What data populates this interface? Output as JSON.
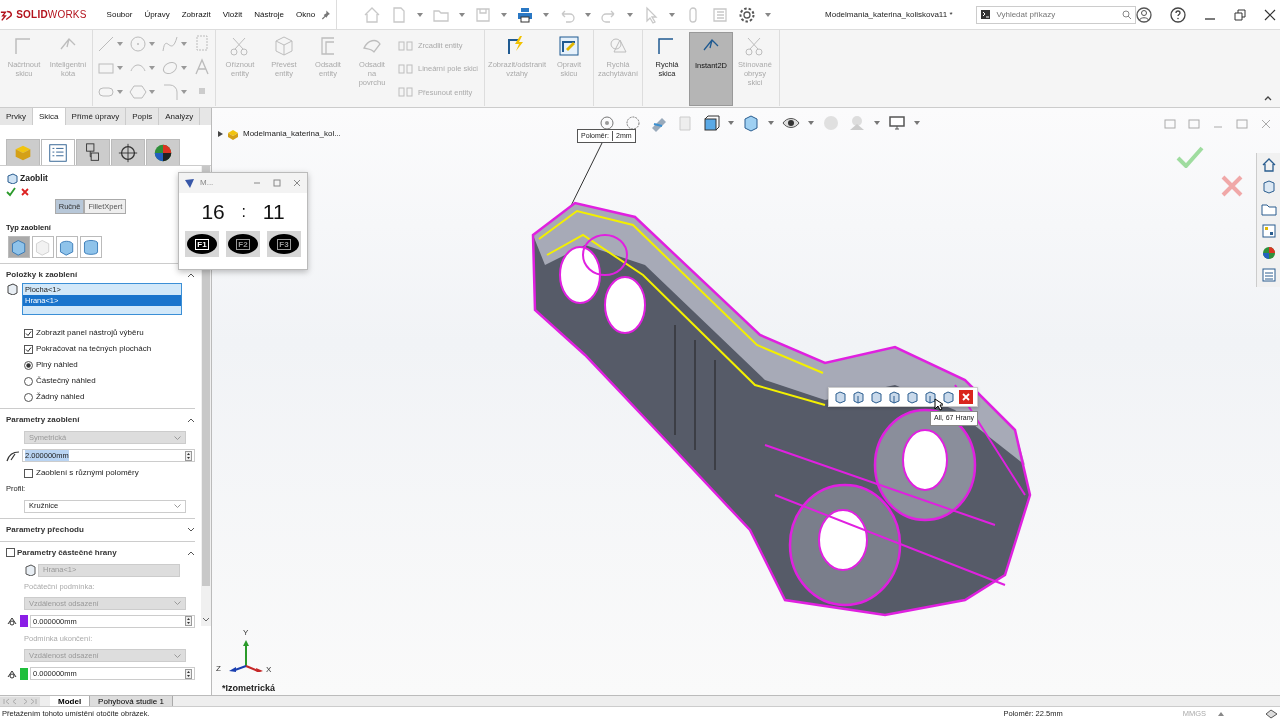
{
  "app_logo": "**SOLID**WORKS",
  "menu": [
    "Soubor",
    "Úpravy",
    "Zobrazit",
    "Vložit",
    "Nástroje",
    "Okno"
  ],
  "document_title": "Modelmania_katerina_koliskova11 *",
  "search": {
    "placeholder": "Vyhledat příkazy"
  },
  "ribbon": {
    "groups": [
      {
        "kind": "tools",
        "tools": [
          {
            "kind": "large",
            "label": "Načrtnout skicu",
            "disabled": true,
            "selected": false
          },
          {
            "kind": "large",
            "label": "Inteligentní kóta",
            "disabled": true,
            "selected": false
          }
        ]
      },
      {
        "kind": "icon_grid"
      },
      {
        "kind": "tools",
        "tools": [
          {
            "kind": "large",
            "label": "Oříznout entity",
            "disabled": true,
            "selected": false
          },
          {
            "kind": "large",
            "label": "Převést entity",
            "disabled": true,
            "selected": false
          },
          {
            "kind": "large",
            "label": "Odsadit entity",
            "disabled": true,
            "selected": false
          },
          {
            "kind": "large",
            "label": "Odsadit na povrchu",
            "disabled": true,
            "selected": false
          },
          {
            "kind": "small",
            "label": "Zrcadlit entity",
            "disabled": true,
            "selected": false
          },
          {
            "kind": "small",
            "label": "Lineární pole skici",
            "disabled": true,
            "selected": false
          },
          {
            "kind": "small",
            "label": "Přesunout entity",
            "disabled": true,
            "selected": false
          }
        ]
      },
      {
        "kind": "tools",
        "tools": [
          {
            "kind": "large",
            "label": "Zobrazit/odstranit vztahy",
            "disabled": true,
            "selected": false
          },
          {
            "kind": "large",
            "label": "Opravit skicu",
            "disabled": true,
            "selected": false
          }
        ]
      },
      {
        "kind": "tools",
        "tools": [
          {
            "kind": "large",
            "label": "Rychlá zachytávání",
            "disabled": true,
            "selected": false
          }
        ]
      },
      {
        "kind": "tools",
        "tools": [
          {
            "kind": "large",
            "label": "Rychlá skica",
            "disabled": false,
            "selected": false
          },
          {
            "kind": "large",
            "label": "Instant2D",
            "disabled": false,
            "selected": true
          },
          {
            "kind": "large",
            "label": "Stínované obrysy skici",
            "disabled": true,
            "selected": false
          }
        ]
      }
    ]
  },
  "command_tabs": [
    {
      "label": "Prvky",
      "selected": false
    },
    {
      "label": "Skica",
      "selected": true
    },
    {
      "label": "Přímé úpravy",
      "selected": false
    },
    {
      "label": "Popis",
      "selected": false
    },
    {
      "label": "Analýzy",
      "selected": false
    }
  ],
  "panel_tabs": [
    {
      "selected": false
    },
    {
      "selected": true
    },
    {
      "selected": false
    },
    {
      "selected": false
    },
    {
      "selected": false
    }
  ],
  "property_manager": {
    "title": "Zaoblit",
    "modes": [
      {
        "label": "Ručně",
        "selected": true
      },
      {
        "label": "FilletXpert",
        "selected": false
      }
    ],
    "fillet_type": {
      "title": "Typ zaoblení",
      "options": [
        {
          "selected": true,
          "disabled": false
        },
        {
          "selected": false,
          "disabled": true
        },
        {
          "selected": false,
          "disabled": false
        },
        {
          "selected": false,
          "disabled": false
        }
      ]
    },
    "sections": [
      {
        "title": "Položky k zaoblení",
        "expanded": true,
        "rows": [
          {
            "kind": "selection_list",
            "items": [
              {
                "label": "Plocha<1>",
                "selected": false
              },
              {
                "label": "Hrana<1>",
                "selected": true
              }
            ]
          },
          {
            "kind": "checkbox",
            "label": "Zobrazit panel nástrojů výběru",
            "checked": true
          },
          {
            "kind": "checkbox",
            "label": "Pokračovat na tečných plochách",
            "checked": true
          },
          {
            "kind": "radio",
            "label": "Plný náhled",
            "selected": true
          },
          {
            "kind": "radio",
            "label": "Částečný náhled",
            "selected": false
          },
          {
            "kind": "radio",
            "label": "Žádný náhled",
            "selected": false
          }
        ]
      },
      {
        "title": "Parametry zaoblení",
        "expanded": true,
        "rows": [
          {
            "kind": "dropdown",
            "value": "Symetrická",
            "disabled": true
          },
          {
            "kind": "number",
            "value": "2.000000mm"
          },
          {
            "kind": "checkbox",
            "label": "Zaoblení s různými poloměry",
            "checked": false
          },
          {
            "kind": "label",
            "text": "Profil:",
            "disabled": false
          },
          {
            "kind": "dropdown",
            "value": "Kružnice",
            "disabled": false
          }
        ]
      },
      {
        "title": "Parametry přechodu",
        "expanded": false
      },
      {
        "title": "Parametry částečné hrany",
        "expanded": true,
        "checked": false,
        "rows": [
          {
            "kind": "selection_field",
            "value": "Hrana<1>"
          },
          {
            "kind": "label",
            "text": "Počáteční podmínka:",
            "disabled": true
          },
          {
            "kind": "dropdown",
            "value": "Vzdálenost odsazení",
            "disabled": true
          },
          {
            "kind": "number",
            "value": "0.000000mm",
            "color": "#8b1ee6"
          },
          {
            "kind": "label",
            "text": "Podmínka ukončení:",
            "disabled": true
          },
          {
            "kind": "dropdown",
            "value": "Vzdálenost odsazení",
            "disabled": true
          },
          {
            "kind": "number",
            "value": "0.000000mm",
            "color": "#1fbf3c"
          }
        ]
      }
    ]
  },
  "model_tree": {
    "label": "Modelmania_katerina_kol..."
  },
  "dimension_tag": {
    "label": "Poloměr:",
    "value": "2mm"
  },
  "selection_toolbar": {
    "tooltip": "All, 67 Hrany"
  },
  "triad_axes": [
    "X",
    "Y",
    "Z"
  ],
  "view_name": "*Izometrická",
  "timer_window": {
    "title": "M...",
    "hours": "16",
    "separator": ":",
    "minutes": "11",
    "keys": [
      {
        "label": "F1",
        "disabled": false
      },
      {
        "label": "F2",
        "disabled": true
      },
      {
        "label": "F3",
        "disabled": true
      }
    ]
  },
  "bottom_tabs": [
    {
      "label": "Model",
      "selected": true
    },
    {
      "label": "Pohybová studie 1",
      "selected": false
    }
  ],
  "status_bar": {
    "message": "Přetažením tohoto umístění otočíte obrázek.",
    "readout": "Poloměr: 22.5mm",
    "units": "MMGS"
  }
}
